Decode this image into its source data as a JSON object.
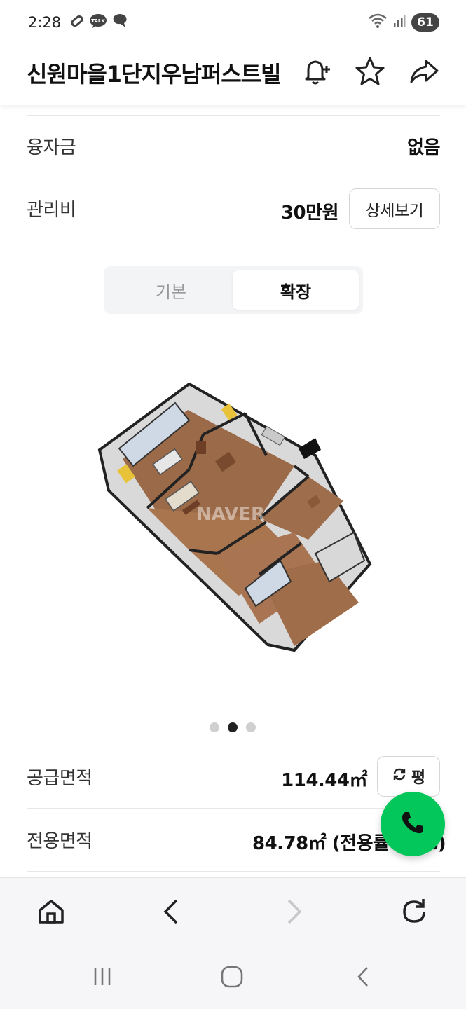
{
  "status_bar": {
    "time": "2:28",
    "battery": "61",
    "left_icons": [
      "link-icon",
      "kakaotalk-icon",
      "chat-icon"
    ],
    "right_icons": [
      "wifi-icon",
      "signal-icon",
      "battery-icon"
    ]
  },
  "header": {
    "title": "신원마을1단지우남퍼스트빌",
    "icons": [
      "bell-plus-icon",
      "star-icon",
      "share-icon"
    ]
  },
  "info_rows": [
    {
      "label": "융자금",
      "value": "없음"
    },
    {
      "label": "관리비",
      "value": "30만원",
      "button": "상세보기"
    }
  ],
  "floorplan_toggle": {
    "options": [
      "기본",
      "확장"
    ],
    "selected": "확장"
  },
  "floorplan": {
    "watermark": "NAVER",
    "pagination": {
      "total": 3,
      "current": 2
    }
  },
  "area_rows": [
    {
      "label": "공급면적",
      "value": "114.44㎡",
      "button": "평"
    },
    {
      "label": "전용면적",
      "value": "84.78㎡ (전용률 74%)"
    }
  ],
  "browser_nav": {
    "icons": [
      "home-icon",
      "back-icon",
      "forward-icon",
      "refresh-icon"
    ]
  },
  "system_nav": {
    "icons": [
      "recent-apps-icon",
      "home-circle-icon",
      "system-back-icon"
    ]
  },
  "colors": {
    "call_button": "#03c75a",
    "active_dot": "#222222",
    "inactive_dot": "#cfcfcf"
  }
}
